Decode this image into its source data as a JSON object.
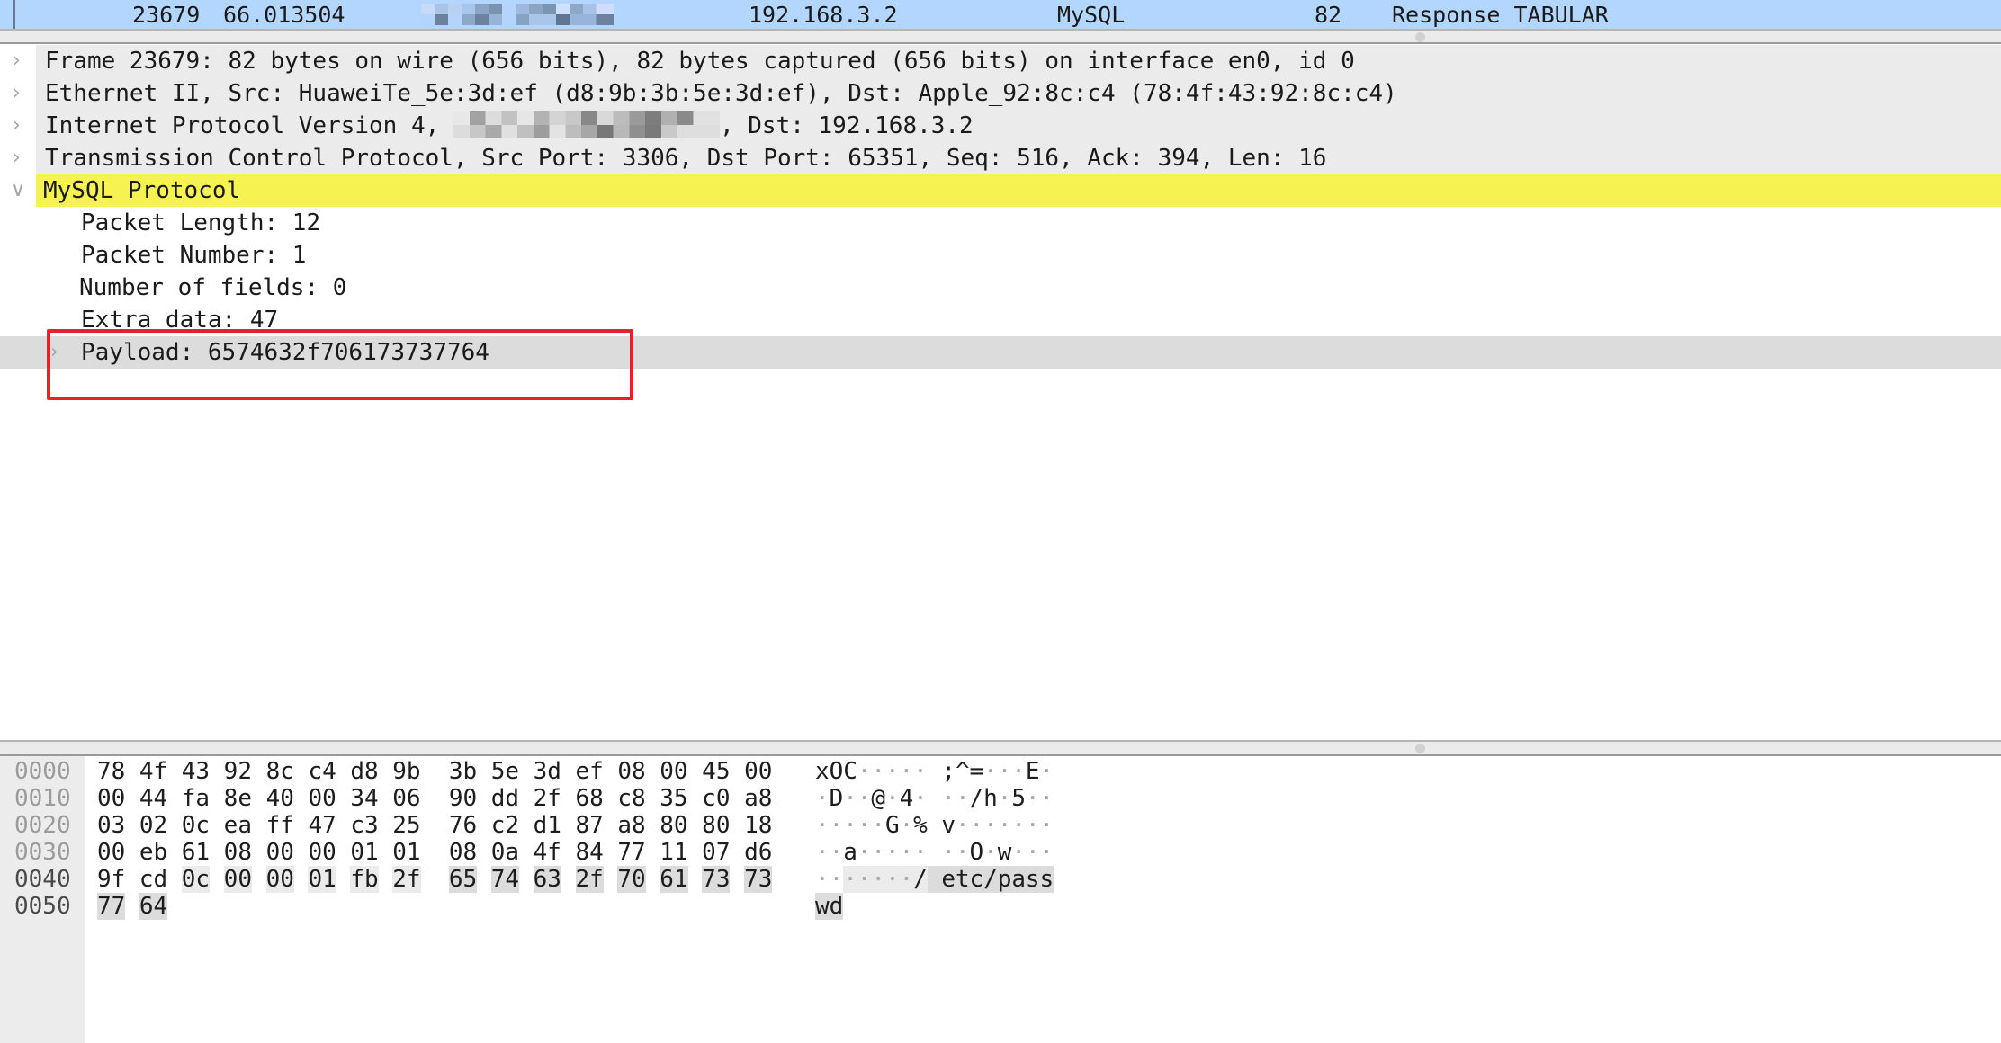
{
  "packet_list": {
    "selected_row": {
      "no": "23679",
      "time": "66.013504",
      "source": "[redacted]",
      "destination": "192.168.3.2",
      "protocol": "MySQL",
      "length": "82",
      "info": "Response TABULAR"
    }
  },
  "details_tree": {
    "rows": [
      {
        "label": "Frame 23679: 82 bytes on wire (656 bits), 82 bytes captured (656 bits) on interface en0, id 0",
        "expanded": false
      },
      {
        "label": "Ethernet II, Src: HuaweiTe_5e:3d:ef (d8:9b:3b:5e:3d:ef), Dst: Apple_92:8c:c4 (78:4f:43:92:8c:c4)",
        "expanded": false
      },
      {
        "label_prefix": "Internet Protocol Version 4, ",
        "label_redacted": "[redacted]",
        "label_suffix": ", Dst: 192.168.3.2",
        "expanded": false
      },
      {
        "label": "Transmission Control Protocol, Src Port: 3306, Dst Port: 65351, Seq: 516, Ack: 394, Len: 16",
        "expanded": false
      },
      {
        "label": "MySQL Protocol",
        "expanded": true,
        "highlight_color": "#f6f252"
      }
    ],
    "mysql_children": [
      {
        "label": "Packet Length: 12"
      },
      {
        "label": "Packet Number: 1"
      },
      {
        "label": "Number of fields: 0"
      },
      {
        "label": "Extra data: 47"
      },
      {
        "label": "Payload: 6574632f706173737764",
        "expanded": false,
        "selected": true
      }
    ],
    "annotation_box_color": "#e5212b"
  },
  "hex_dump": {
    "rows": [
      {
        "offset": "0000",
        "bytes": [
          "78",
          "4f",
          "43",
          "92",
          "8c",
          "c4",
          "d8",
          "9b",
          "3b",
          "5e",
          "3d",
          "ef",
          "08",
          "00",
          "45",
          "00"
        ],
        "ascii": [
          "x",
          "O",
          "C",
          "·",
          "·",
          "·",
          "·",
          "·",
          ";",
          "^",
          "=",
          "·",
          "·",
          "·",
          "E",
          "·"
        ]
      },
      {
        "offset": "0010",
        "bytes": [
          "00",
          "44",
          "fa",
          "8e",
          "40",
          "00",
          "34",
          "06",
          "90",
          "dd",
          "2f",
          "68",
          "c8",
          "35",
          "c0",
          "a8"
        ],
        "ascii": [
          "·",
          "D",
          "·",
          "·",
          "@",
          "·",
          "4",
          "·",
          "·",
          "·",
          "/",
          "h",
          "·",
          "5",
          "·",
          "·"
        ]
      },
      {
        "offset": "0020",
        "bytes": [
          "03",
          "02",
          "0c",
          "ea",
          "ff",
          "47",
          "c3",
          "25",
          "76",
          "c2",
          "d1",
          "87",
          "a8",
          "80",
          "80",
          "18"
        ],
        "ascii": [
          "·",
          "·",
          "·",
          "·",
          "·",
          "G",
          "·",
          "%",
          "v",
          "·",
          "·",
          "·",
          "·",
          "·",
          "·",
          "·"
        ]
      },
      {
        "offset": "0030",
        "bytes": [
          "00",
          "eb",
          "61",
          "08",
          "00",
          "00",
          "01",
          "01",
          "08",
          "0a",
          "4f",
          "84",
          "77",
          "11",
          "07",
          "d6"
        ],
        "ascii": [
          "·",
          "·",
          "a",
          "·",
          "·",
          "·",
          "·",
          "·",
          "·",
          "·",
          "O",
          "·",
          "w",
          "·",
          "·",
          "·"
        ]
      },
      {
        "offset": "0040",
        "bytes": [
          "9f",
          "cd",
          "0c",
          "00",
          "00",
          "01",
          "fb",
          "2f",
          "65",
          "74",
          "63",
          "2f",
          "70",
          "61",
          "73",
          "73"
        ],
        "ascii": [
          "·",
          "·",
          "·",
          "·",
          "·",
          "·",
          "·",
          "/",
          "e",
          "t",
          "c",
          "/",
          "p",
          "a",
          "s",
          "s"
        ]
      },
      {
        "offset": "0050",
        "bytes": [
          "77",
          "64"
        ],
        "ascii": [
          "w",
          "d"
        ]
      }
    ],
    "protocol_range": {
      "start": 66,
      "end": 81
    },
    "field_range": {
      "start": 72,
      "end": 81
    },
    "selected_ascii_text": "etc/passwd"
  }
}
